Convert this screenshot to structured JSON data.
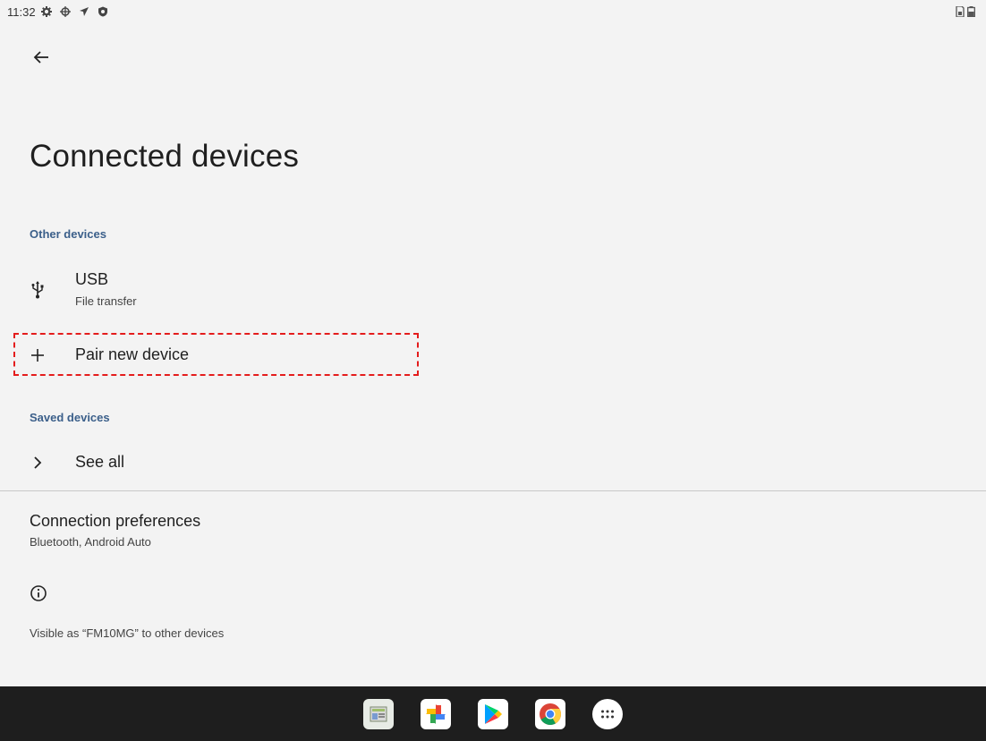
{
  "status_bar": {
    "time": "11:32",
    "icons": [
      "settings-gear-icon",
      "cross-target-icon",
      "navigation-arrow-icon",
      "shield-icon"
    ],
    "right_icons": [
      "sim-card-icon",
      "battery-icon"
    ]
  },
  "header": {
    "back_icon": "arrow-left-icon"
  },
  "page": {
    "title": "Connected devices"
  },
  "sections": {
    "other_devices": {
      "header": "Other devices",
      "usb": {
        "title": "USB",
        "subtitle": "File transfer",
        "icon": "usb-icon"
      },
      "pair": {
        "title": "Pair new device",
        "icon": "plus-icon"
      }
    },
    "saved_devices": {
      "header": "Saved devices",
      "see_all": {
        "title": "See all",
        "icon": "chevron-right-icon"
      }
    }
  },
  "connection_preferences": {
    "title": "Connection preferences",
    "subtitle": "Bluetooth, Android Auto"
  },
  "footer_info": {
    "icon": "info-icon",
    "text": "Visible as “FM10MG” to other devices"
  },
  "highlight_color": "#e41c1c",
  "accent_color": "#3b5f8a",
  "dock": {
    "apps": [
      "gallery-app-icon",
      "photos-app-icon",
      "play-store-app-icon",
      "chrome-app-icon",
      "app-drawer-icon"
    ]
  }
}
